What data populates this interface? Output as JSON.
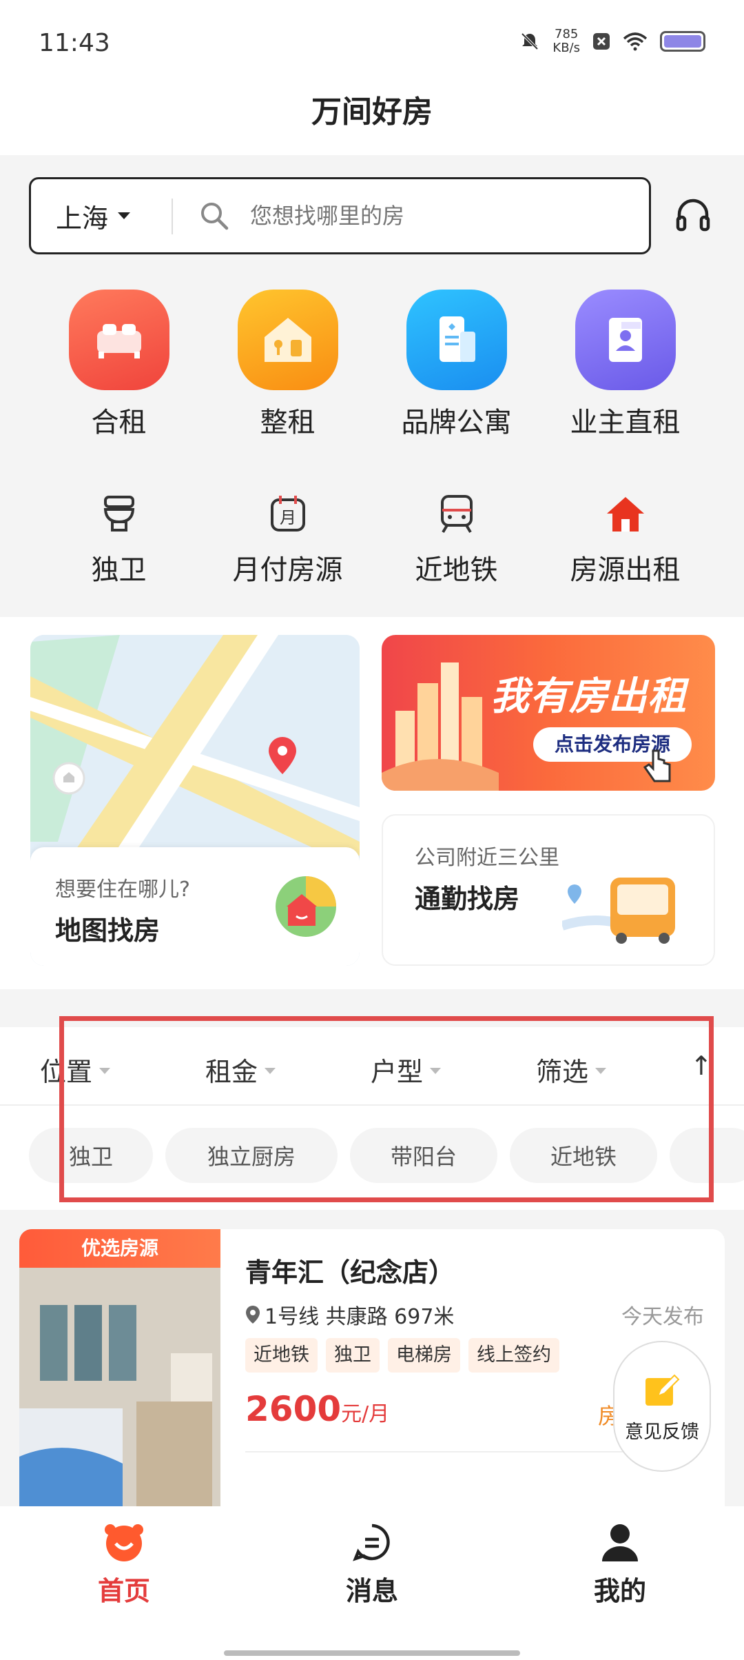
{
  "status_bar": {
    "time": "11:43",
    "net_speed_value": "785",
    "net_speed_unit": "KB/s"
  },
  "header": {
    "title": "万间好房"
  },
  "search": {
    "city": "上海",
    "placeholder": "您想找哪里的房"
  },
  "categories": [
    {
      "label": "合租",
      "icon": "bed-icon",
      "color": "#f45a4a"
    },
    {
      "label": "整租",
      "icon": "house-icon",
      "color": "#fca41e"
    },
    {
      "label": "品牌公寓",
      "icon": "building-icon",
      "color": "#22a8f4"
    },
    {
      "label": "业主直租",
      "icon": "owner-icon",
      "color": "#7b6ef0"
    }
  ],
  "subcategories": [
    {
      "label": "独卫",
      "icon": "toilet-icon"
    },
    {
      "label": "月付房源",
      "icon": "calendar-icon"
    },
    {
      "label": "近地铁",
      "icon": "subway-icon"
    },
    {
      "label": "房源出租",
      "icon": "home-red-icon"
    }
  ],
  "map_card": {
    "subtitle": "想要住在哪儿?",
    "title": "地图找房"
  },
  "banner": {
    "title": "我有房出租",
    "button": "点击发布房源"
  },
  "commute_card": {
    "subtitle": "公司附近三公里",
    "title": "通勤找房"
  },
  "filters": {
    "tabs": [
      "位置",
      "租金",
      "户型",
      "筛选",
      "↑"
    ],
    "chips": [
      "独卫",
      "独立厨房",
      "带阳台",
      "近地铁"
    ]
  },
  "listing": {
    "badge": "优选房源",
    "title": "青年汇（纪念店）",
    "location": "1号线 共康路 697米",
    "posted": "今天发布",
    "tags": [
      "近地铁",
      "独卫",
      "电梯房",
      "线上签约"
    ],
    "price": "2600",
    "price_unit": "元/月",
    "extra": "房"
  },
  "feedback": {
    "label": "意见反馈"
  },
  "nav": {
    "items": [
      {
        "label": "首页",
        "active": true
      },
      {
        "label": "消息",
        "active": false
      },
      {
        "label": "我的",
        "active": false
      }
    ]
  },
  "colors": {
    "accent": "#e43b3b",
    "highlight_border": "#e04b4b"
  }
}
